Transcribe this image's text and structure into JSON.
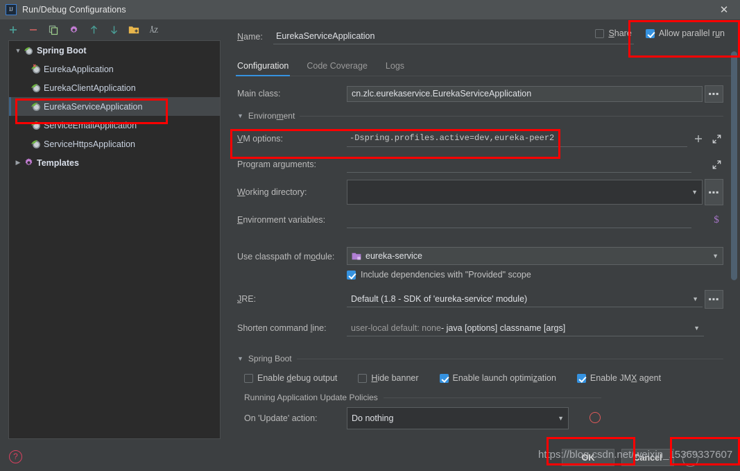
{
  "window": {
    "title": "Run/Debug Configurations",
    "logo_icon": "intellij-idea-icon",
    "close_icon": "close-icon"
  },
  "sidebar": {
    "toolbar": [
      {
        "name": "add-configuration-button",
        "icon": "plus-icon",
        "label": "+"
      },
      {
        "name": "remove-configuration-button",
        "icon": "minus-icon",
        "label": "−"
      },
      {
        "name": "copy-configuration-button",
        "icon": "copy-icon",
        "label": "Copy"
      },
      {
        "name": "edit-templates-button",
        "icon": "gear-icon",
        "label": "Edit Templates"
      },
      {
        "name": "move-up-button",
        "icon": "arrow-up-icon",
        "label": "Move Up"
      },
      {
        "name": "move-down-button",
        "icon": "arrow-down-icon",
        "label": "Move Down"
      },
      {
        "name": "new-folder-button",
        "icon": "folder-plus-icon",
        "label": "New Folder"
      },
      {
        "name": "sort-configurations-button",
        "icon": "sort-alphabetically-icon",
        "label": "AZ"
      }
    ],
    "tree": [
      {
        "label": "Spring Boot",
        "icon": "spring-boot-icon",
        "level": 0,
        "expanded": true,
        "selected": false,
        "group": true
      },
      {
        "label": "EurekaApplication",
        "icon": "spring-boot-error-icon",
        "level": 1,
        "selected": false,
        "group": false
      },
      {
        "label": "EurekaClientApplication",
        "icon": "spring-boot-icon",
        "level": 1,
        "selected": false,
        "group": false
      },
      {
        "label": "EurekaServiceApplication",
        "icon": "spring-boot-icon",
        "level": 1,
        "selected": true,
        "group": false
      },
      {
        "label": "ServiceEmailApplication",
        "icon": "spring-boot-icon",
        "level": 1,
        "selected": false,
        "group": false
      },
      {
        "label": "ServiceHttpsApplication",
        "icon": "spring-boot-icon",
        "level": 1,
        "selected": false,
        "group": false
      },
      {
        "label": "Templates",
        "icon": "gear-icon",
        "level": 0,
        "expanded": false,
        "selected": false,
        "group": true
      }
    ]
  },
  "main": {
    "name_label": "Name:",
    "name_value": "EurekaServiceApplication",
    "share": {
      "label": "Share",
      "checked": false
    },
    "allow_parallel_run": {
      "label": "Allow parallel run",
      "checked": true
    },
    "tabs": [
      {
        "label": "Configuration",
        "active": true
      },
      {
        "label": "Code Coverage",
        "active": false
      },
      {
        "label": "Logs",
        "active": false
      }
    ],
    "fields": {
      "main_class": {
        "label": "Main class:",
        "value": "cn.zlc.eurekaservice.EurekaServiceApplication",
        "browse_icon": "ellipsis-icon"
      },
      "environment_section": {
        "label": "Environment",
        "expanded": true
      },
      "vm_options": {
        "label": "VM options:",
        "value": "-Dspring.profiles.active=dev,eureka-peer2",
        "add_icon": "plus-icon",
        "expand_icon": "expand-icon"
      },
      "program_arguments": {
        "label": "Program arguments:",
        "value": "",
        "expand_icon": "expand-icon"
      },
      "working_directory": {
        "label": "Working directory:",
        "value": "",
        "caret_icon": "chevron-down-icon",
        "browse_icon": "ellipsis-icon"
      },
      "environment_variables": {
        "label": "Environment variables:",
        "value": "",
        "macro_icon": "dollar-icon"
      },
      "use_classpath_of_module": {
        "label": "Use classpath of module:",
        "value": "eureka-service",
        "module_icon": "module-icon",
        "caret_icon": "chevron-down-icon"
      },
      "include_provided": {
        "label": "Include dependencies with \"Provided\" scope",
        "checked": true
      },
      "jre": {
        "label": "JRE:",
        "value": "Default (1.8 - SDK of 'eureka-service' module)",
        "caret_icon": "chevron-down-icon",
        "browse_icon": "ellipsis-icon"
      },
      "shorten_command_line": {
        "label": "Shorten command line:",
        "value_dim": "user-local default: none",
        "value_rest": " - java [options] classname [args]",
        "caret_icon": "chevron-down-icon"
      }
    },
    "spring_boot_section": {
      "label": "Spring Boot",
      "expanded": true,
      "checkboxes": [
        {
          "label": "Enable debug output",
          "checked": false,
          "name": "enable-debug-output-checkbox"
        },
        {
          "label": "Hide banner",
          "checked": false,
          "name": "hide-banner-checkbox"
        },
        {
          "label": "Enable launch optimization",
          "checked": true,
          "name": "enable-launch-optimization-checkbox"
        },
        {
          "label": "Enable JMX agent",
          "checked": true,
          "name": "enable-jmx-agent-checkbox"
        }
      ],
      "update_policies_label": "Running Application Update Policies",
      "on_update_action": {
        "label": "On 'Update' action:",
        "value": "Do nothing",
        "caret_icon": "chevron-down-icon",
        "help_icon": "help-icon"
      }
    }
  },
  "footer": {
    "help_icon": "help-icon",
    "ok_label": "OK",
    "cancel_label": "Cancel",
    "watermark": "https://blog.csdn.net/weixin_15369337607"
  },
  "colors": {
    "accent": "#3592e0",
    "panel_bg": "#3c3f41",
    "tree_bg": "#2b2b2b",
    "annotation": "#ff0000",
    "help_red": "#d9415f"
  }
}
